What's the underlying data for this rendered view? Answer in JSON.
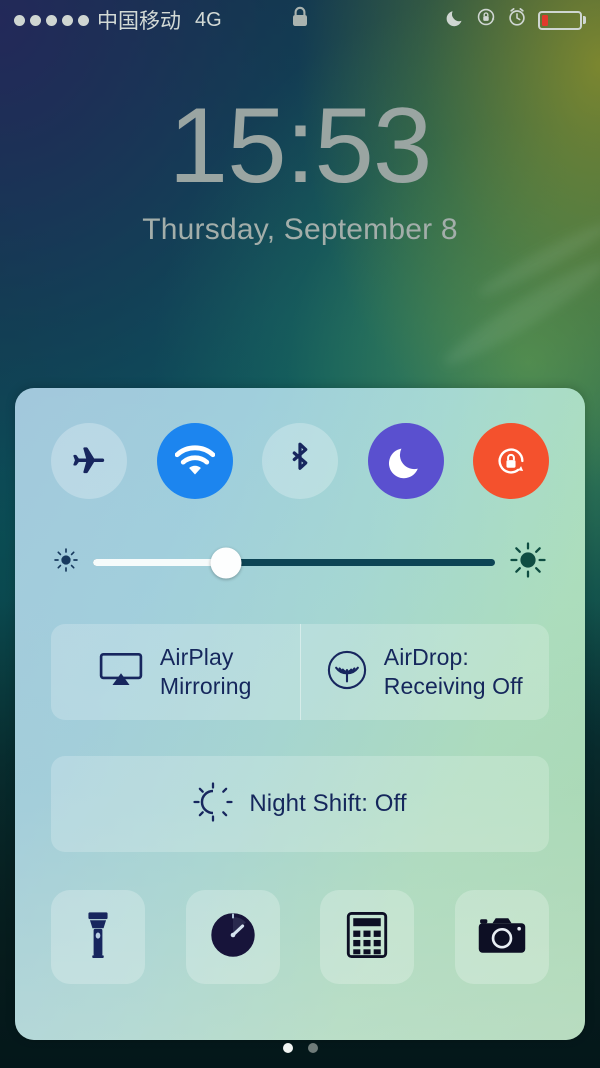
{
  "status_bar": {
    "signal_dots": 5,
    "carrier": "中国移动",
    "network": "4G",
    "center_icon": "lock-icon",
    "right_icons": [
      "moon-icon",
      "rotation-lock-icon",
      "alarm-clock-icon"
    ],
    "battery_percent": 18,
    "battery_color": "#e0392b"
  },
  "lock_screen": {
    "time": "15:53",
    "date": "Thursday, September 8"
  },
  "control_center": {
    "toggles": [
      {
        "name": "airplane-mode",
        "icon": "airplane-icon",
        "state": "off",
        "color": "rgba(255,255,255,0.26)"
      },
      {
        "name": "wifi",
        "icon": "wifi-icon",
        "state": "on",
        "color": "#1c85ef"
      },
      {
        "name": "bluetooth",
        "icon": "bluetooth-icon",
        "state": "off",
        "color": "rgba(255,255,255,0.26)"
      },
      {
        "name": "do-not-disturb",
        "icon": "moon-icon",
        "state": "on",
        "color": "#5a50cf"
      },
      {
        "name": "rotation-lock",
        "icon": "rotation-lock-icon",
        "state": "on",
        "color": "#f4512d"
      }
    ],
    "brightness": {
      "name": "brightness-slider",
      "value": 33,
      "min_icon": "sun-small-icon",
      "max_icon": "sun-large-icon"
    },
    "media": [
      {
        "name": "airplay-mirroring",
        "icon": "airplay-icon",
        "line1": "AirPlay",
        "line2": "Mirroring"
      },
      {
        "name": "airdrop",
        "icon": "airdrop-icon",
        "line1": "AirDrop:",
        "line2": "Receiving Off"
      }
    ],
    "night_shift": {
      "name": "night-shift",
      "icon": "night-shift-icon",
      "label": "Night Shift: Off"
    },
    "shortcuts": [
      {
        "name": "flashlight",
        "icon": "flashlight-icon"
      },
      {
        "name": "timer",
        "icon": "timer-icon"
      },
      {
        "name": "calculator",
        "icon": "calculator-icon"
      },
      {
        "name": "camera",
        "icon": "camera-icon"
      }
    ]
  },
  "page_indicator": {
    "total": 2,
    "active": 1
  },
  "theme": {
    "icon_dark": "#15275c",
    "accent_wifi": "#1c85ef",
    "accent_dnd": "#5a50cf",
    "accent_lock": "#f4512d"
  }
}
